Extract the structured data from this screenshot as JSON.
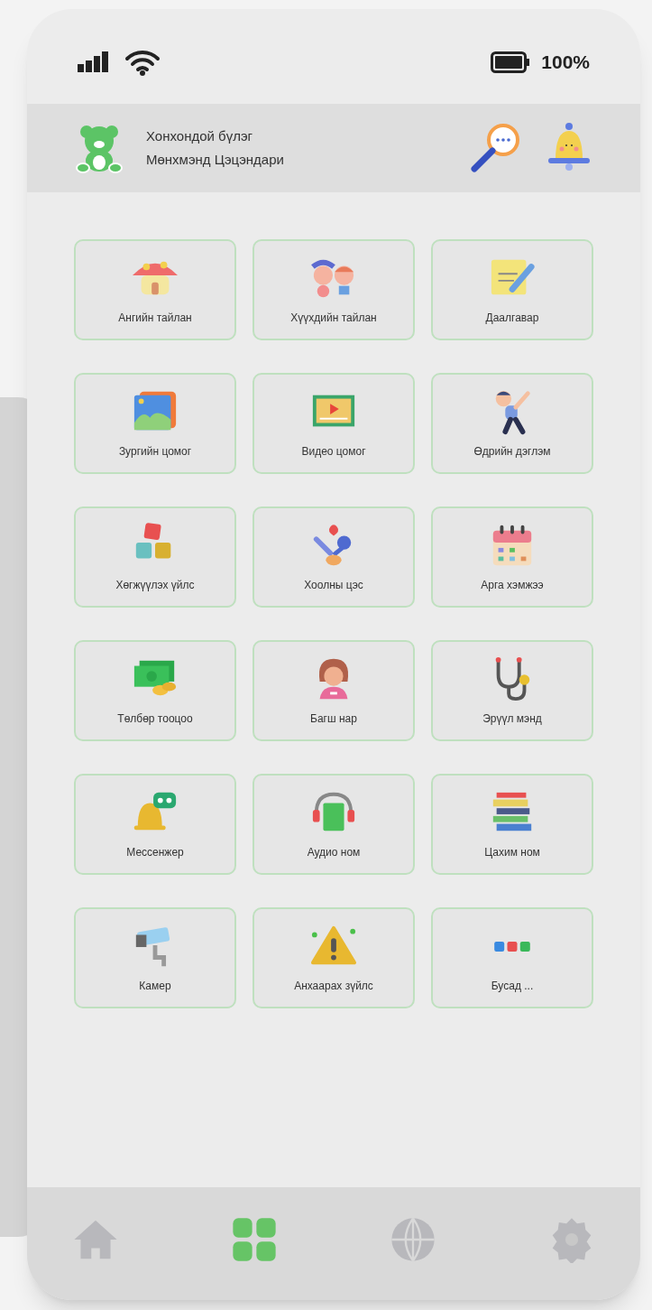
{
  "status_bar": {
    "battery": "100%"
  },
  "header": {
    "line_1": "Хонхондой бүлэг",
    "line_2": "Мөнхмэнд Цэцэндари"
  },
  "tiles": [
    {
      "label": "Ангийн тайлан"
    },
    {
      "label": "Хүүхдийн тайлан"
    },
    {
      "label": "Даалгавар"
    },
    {
      "label": "Зургийн цомог"
    },
    {
      "label": "Видео цомог"
    },
    {
      "label": "Өдрийн дэглэм"
    },
    {
      "label": "Хөгжүүлэх үйлс"
    },
    {
      "label": "Хоолны цэс"
    },
    {
      "label": "Арга хэмжээ"
    },
    {
      "label": "Төлбөр тооцоо"
    },
    {
      "label": "Багш нар"
    },
    {
      "label": "Эрүүл мэнд"
    },
    {
      "label": "Мессенжер"
    },
    {
      "label": "Аудио ном"
    },
    {
      "label": "Цахим ном"
    },
    {
      "label": "Камер"
    },
    {
      "label": "Анхаарах зүйлс"
    },
    {
      "label": "Бусад ..."
    }
  ],
  "bottom_nav": [
    {
      "kind": "home",
      "selected": false
    },
    {
      "kind": "grid",
      "selected": true
    },
    {
      "kind": "globe",
      "selected": false
    },
    {
      "kind": "settings",
      "selected": false
    }
  ]
}
